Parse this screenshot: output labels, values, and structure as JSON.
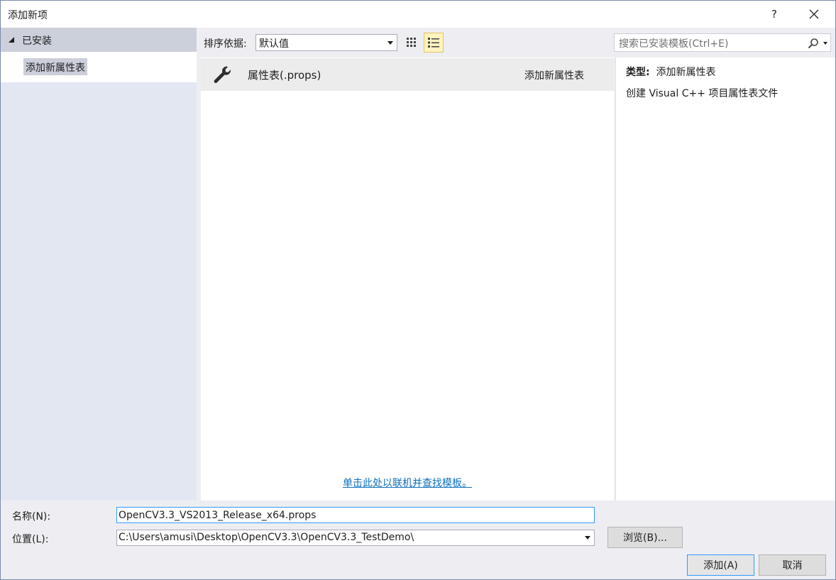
{
  "window": {
    "title": "添加新项",
    "help_label": "?",
    "close_icon": "close-icon"
  },
  "sidebar": {
    "root_label": "已安装",
    "items": [
      {
        "label": "添加新属性表",
        "selected": true
      }
    ]
  },
  "toolbar": {
    "sort_label": "排序依据:",
    "sort_value": "默认值",
    "view_modes": [
      "grid-view-icon",
      "list-view-icon"
    ],
    "active_view": "list"
  },
  "search": {
    "placeholder": "搜索已安装模板(Ctrl+E)",
    "icon": "search-icon"
  },
  "templates": [
    {
      "name": "属性表(.props)",
      "type": "添加新属性表",
      "icon": "wrench-icon"
    }
  ],
  "online_link": "单击此处以联机并查找模板。",
  "details": {
    "type_key": "类型:",
    "type_value": "添加新属性表",
    "description": "创建 Visual C++ 项目属性表文件"
  },
  "form": {
    "name_label": "名称(N):",
    "name_value": "OpenCV3.3_VS2013_Release_x64.props",
    "location_label": "位置(L):",
    "location_value": "C:\\Users\\amusi\\Desktop\\OpenCV3.3\\OpenCV3.3_TestDemo\\",
    "browse_label": "浏览(B)...",
    "add_label": "添加(A)",
    "cancel_label": "取消"
  },
  "colors": {
    "accent": "#3399ff",
    "link": "#0e70c0",
    "selected_view_bg": "#fdf4bf"
  }
}
